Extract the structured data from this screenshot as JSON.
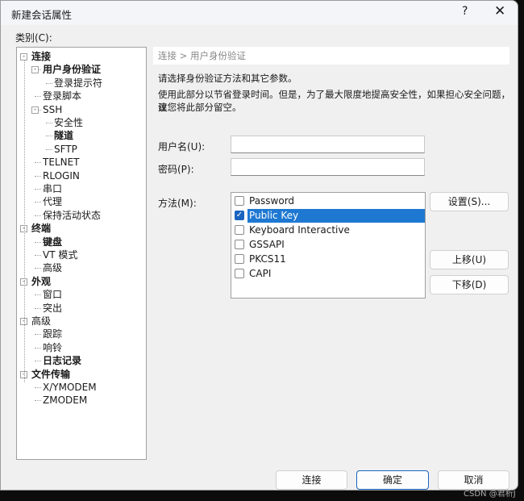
{
  "window": {
    "title": "新建会话属性",
    "help": "?",
    "close": "✕"
  },
  "category_label": "类别(C):",
  "tree": [
    {
      "label": "连接",
      "level": 0,
      "bold": true,
      "expander": "-"
    },
    {
      "label": "用户身份验证",
      "level": 1,
      "bold": true,
      "expander": "-"
    },
    {
      "label": "登录提示符",
      "level": 2,
      "bold": false
    },
    {
      "label": "登录脚本",
      "level": 1,
      "bold": false
    },
    {
      "label": "SSH",
      "level": 1,
      "bold": false,
      "expander": "-"
    },
    {
      "label": "安全性",
      "level": 2,
      "bold": false
    },
    {
      "label": "隧道",
      "level": 2,
      "bold": true
    },
    {
      "label": "SFTP",
      "level": 2,
      "bold": false
    },
    {
      "label": "TELNET",
      "level": 1,
      "bold": false
    },
    {
      "label": "RLOGIN",
      "level": 1,
      "bold": false
    },
    {
      "label": "串口",
      "level": 1,
      "bold": false
    },
    {
      "label": "代理",
      "level": 1,
      "bold": false
    },
    {
      "label": "保持活动状态",
      "level": 1,
      "bold": false
    },
    {
      "label": "终端",
      "level": 0,
      "bold": true,
      "expander": "-"
    },
    {
      "label": "键盘",
      "level": 1,
      "bold": true
    },
    {
      "label": "VT 模式",
      "level": 1,
      "bold": false
    },
    {
      "label": "高级",
      "level": 1,
      "bold": false
    },
    {
      "label": "外观",
      "level": 0,
      "bold": true,
      "expander": "-"
    },
    {
      "label": "窗口",
      "level": 1,
      "bold": false
    },
    {
      "label": "突出",
      "level": 1,
      "bold": false
    },
    {
      "label": "高级",
      "level": 0,
      "bold": false,
      "expander": "-"
    },
    {
      "label": "跟踪",
      "level": 1,
      "bold": false
    },
    {
      "label": "响铃",
      "level": 1,
      "bold": false
    },
    {
      "label": "日志记录",
      "level": 1,
      "bold": true
    },
    {
      "label": "文件传输",
      "level": 0,
      "bold": true,
      "expander": "-"
    },
    {
      "label": "X/YMODEM",
      "level": 1,
      "bold": false
    },
    {
      "label": "ZMODEM",
      "level": 1,
      "bold": false
    }
  ],
  "breadcrumb": "连接 > 用户身份验证",
  "intro": "请选择身份验证方法和其它参数。",
  "note_line1": "使用此部分以节省登录时间。但是，为了最大限度地提高安全性，如果担心安全问题，建",
  "note_line2": "议您将此部分留空。",
  "username_label": "用户名(U):",
  "username_value": "",
  "password_label": "密码(P):",
  "password_value": "",
  "method_label": "方法(M):",
  "methods": [
    {
      "label": "Password",
      "checked": false,
      "selected": false
    },
    {
      "label": "Public Key",
      "checked": true,
      "selected": true
    },
    {
      "label": "Keyboard Interactive",
      "checked": false,
      "selected": false
    },
    {
      "label": "GSSAPI",
      "checked": false,
      "selected": false
    },
    {
      "label": "PKCS11",
      "checked": false,
      "selected": false
    },
    {
      "label": "CAPI",
      "checked": false,
      "selected": false
    }
  ],
  "buttons": {
    "settings": "设置(S)...",
    "move_up": "上移(U)",
    "move_down": "下移(D)",
    "connect": "连接",
    "ok": "确定",
    "cancel": "取消"
  },
  "watermark": "CSDN @君析J"
}
